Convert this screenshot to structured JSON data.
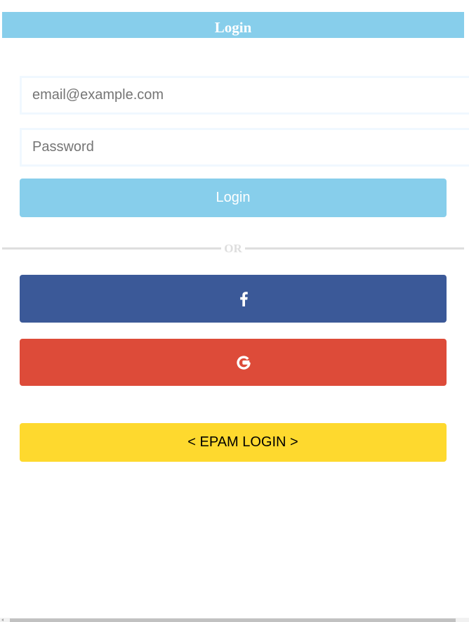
{
  "header": {
    "title": "Login"
  },
  "form": {
    "email_placeholder": "email@example.com",
    "password_placeholder": "Password",
    "login_label": "Login"
  },
  "divider": {
    "text": "OR"
  },
  "social": {
    "facebook_icon": "facebook-f-icon",
    "google_icon": "google-g-icon"
  },
  "epam": {
    "label": "< EPAM LOGIN >"
  },
  "colors": {
    "primary": "#87ceeb",
    "facebook": "#3b5998",
    "google": "#dd4b39",
    "epam": "#fed92e",
    "divider": "#dedede"
  }
}
